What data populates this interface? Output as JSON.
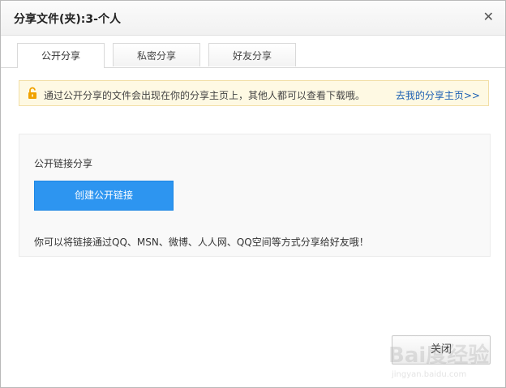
{
  "dialog": {
    "title": "分享文件(夹):3-个人",
    "close_icon": "close-x-icon"
  },
  "tabs": [
    {
      "label": "公开分享",
      "active": true
    },
    {
      "label": "私密分享",
      "active": false
    },
    {
      "label": "好友分享",
      "active": false
    }
  ],
  "notice": {
    "icon": "unlock-icon",
    "text": "通过公开分享的文件会出现在你的分享主页上，其他人都可以查看下载哦。",
    "link": "去我的分享主页>>"
  },
  "panel": {
    "title": "公开链接分享",
    "create_button": "创建公开链接",
    "description": "你可以将链接通过QQ、MSN、微博、人人网、QQ空间等方式分享给好友哦！"
  },
  "footer": {
    "close_button": "关闭"
  },
  "watermark": {
    "brand": "Bai度经验",
    "url": "jingyan.baidu.com"
  },
  "colors": {
    "accent": "#2d95f0",
    "link": "#1b5fb3",
    "notice_bg": "#fef9e3",
    "lock_icon": "#f0a200"
  }
}
